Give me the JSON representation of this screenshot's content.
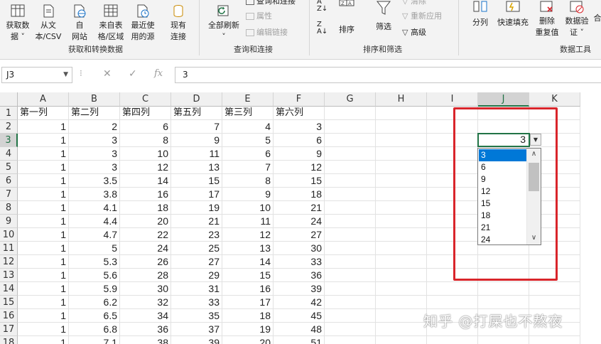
{
  "ribbon": {
    "group1": {
      "label": "获取和转换数据",
      "buttons": [
        {
          "line1": "获取数",
          "line2": "据 ˅",
          "icon": "table-icon"
        },
        {
          "line1": "从文",
          "line2": "本/CSV",
          "icon": "text-file-icon"
        },
        {
          "line1": "自",
          "line2": "网站",
          "icon": "web-icon"
        },
        {
          "line1": "来自表",
          "line2": "格/区域",
          "icon": "table-range-icon"
        },
        {
          "line1": "最近使",
          "line2": "用的源",
          "icon": "recent-source-icon"
        },
        {
          "line1": "现有",
          "line2": "连接",
          "icon": "connection-icon"
        }
      ]
    },
    "group2": {
      "label": "查询和连接",
      "refresh_line1": "全部刷新",
      "refresh_line2": "˅",
      "items": [
        "查询和连接",
        "属性",
        "编辑链接"
      ]
    },
    "group3": {
      "label": "排序和筛选",
      "sort_label": "排序",
      "filter_label": "筛选",
      "items": [
        "清除",
        "重新应用",
        "高级"
      ]
    },
    "group4": {
      "label": "数据工具",
      "buttons": [
        {
          "line1": "分列",
          "line2": ""
        },
        {
          "line1": "快速填充",
          "line2": ""
        },
        {
          "line1": "删除",
          "line2": "重复值"
        },
        {
          "line1": "数据验",
          "line2": "证 ˅"
        },
        {
          "line1": "合",
          "line2": ""
        }
      ]
    }
  },
  "formula_bar": {
    "name_box": "J3",
    "dots": "⁝",
    "cancel": "✕",
    "enter": "✓",
    "fx": "fx",
    "value": "3"
  },
  "sheet": {
    "columns": [
      "A",
      "B",
      "C",
      "D",
      "E",
      "F",
      "G",
      "H",
      "I",
      "J",
      "K"
    ],
    "selected_column": "J",
    "selected_row": 3,
    "headers": [
      "第一列",
      "第二列",
      "第四列",
      "第五列",
      "第三列",
      "第六列"
    ],
    "rows": [
      [
        1,
        2,
        6,
        7,
        4,
        3
      ],
      [
        1,
        3,
        8,
        9,
        5,
        6
      ],
      [
        1,
        3,
        10,
        11,
        6,
        9
      ],
      [
        1,
        3,
        12,
        13,
        7,
        12
      ],
      [
        1,
        3.5,
        14,
        15,
        8,
        15
      ],
      [
        1,
        3.8,
        16,
        17,
        9,
        18
      ],
      [
        1,
        4.1,
        18,
        19,
        10,
        21
      ],
      [
        1,
        4.4,
        20,
        21,
        11,
        24
      ],
      [
        1,
        4.7,
        22,
        23,
        12,
        27
      ],
      [
        1,
        5,
        24,
        25,
        13,
        30
      ],
      [
        1,
        5.3,
        26,
        27,
        14,
        33
      ],
      [
        1,
        5.6,
        28,
        29,
        15,
        36
      ],
      [
        1,
        5.9,
        30,
        31,
        16,
        39
      ],
      [
        1,
        6.2,
        32,
        33,
        17,
        42
      ],
      [
        1,
        6.5,
        34,
        35,
        18,
        45
      ],
      [
        1,
        6.8,
        36,
        37,
        19,
        48
      ],
      [
        1,
        7.1,
        38,
        39,
        20,
        51
      ]
    ],
    "active_cell": {
      "ref": "J3",
      "value": "3"
    },
    "dropdown": {
      "options": [
        "3",
        "6",
        "9",
        "12",
        "15",
        "18",
        "21",
        "24"
      ],
      "selected_index": 0
    }
  },
  "watermark": "知乎 @打屎也不熬夜",
  "colors": {
    "excel_green": "#217346",
    "highlight_red": "#d9252b",
    "selection_blue": "#0078d7"
  }
}
